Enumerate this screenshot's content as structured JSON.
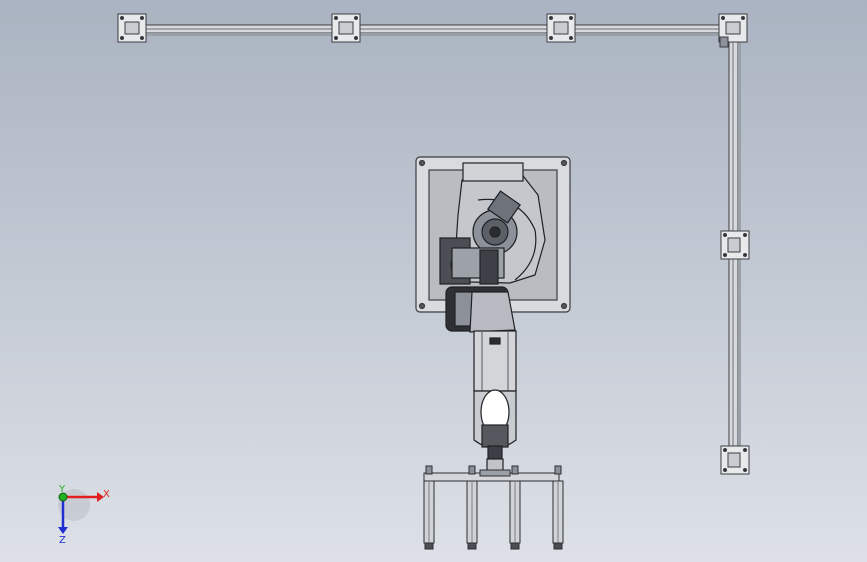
{
  "viewport": {
    "name": "cad-graphics-area",
    "background_top": "#aab3c1",
    "background_bottom": "#dde1e7"
  },
  "model": {
    "frame": {
      "name": "aluminium-profile-frame",
      "color": "#5a5f66"
    },
    "robot": {
      "name": "six-axis-robot-top-view",
      "color": "#2b2d31"
    },
    "gripper": {
      "name": "four-finger-end-effector",
      "finger_count": 4
    }
  },
  "triad": {
    "x_label": "X",
    "y_label": "Y",
    "z_label": "Z",
    "x_color": "#e02020",
    "y_color": "#20b020",
    "z_color": "#2030d0"
  }
}
